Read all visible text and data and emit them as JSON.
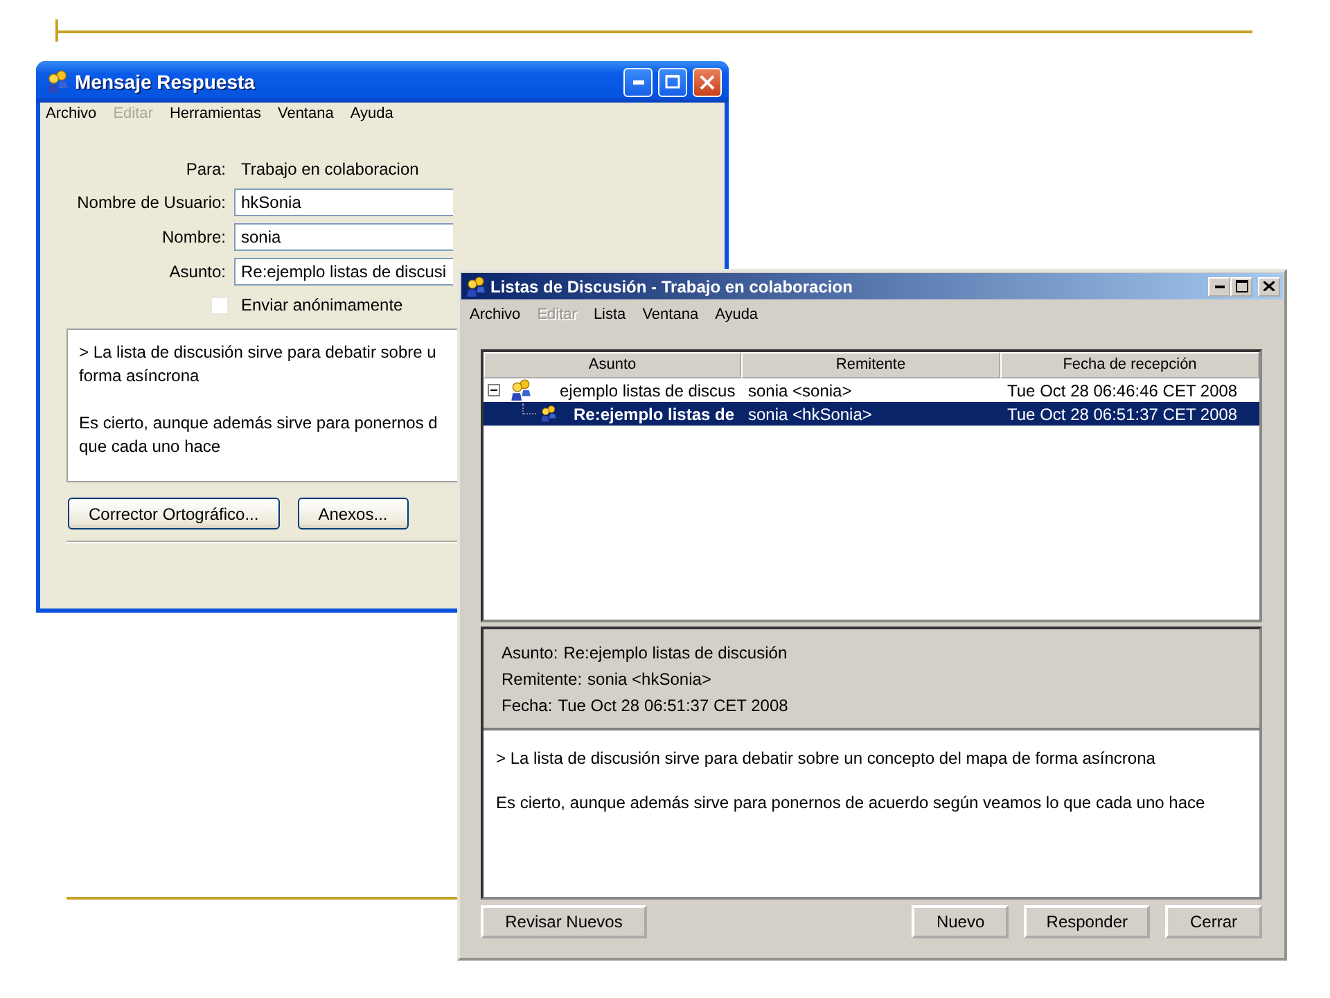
{
  "reply_window": {
    "title": "Mensaje Respuesta",
    "menu": [
      {
        "label": "Archivo",
        "disabled": false
      },
      {
        "label": "Editar",
        "disabled": true
      },
      {
        "label": "Herramientas",
        "disabled": false
      },
      {
        "label": "Ventana",
        "disabled": false
      },
      {
        "label": "Ayuda",
        "disabled": false
      }
    ],
    "fields": [
      {
        "label": "Para:",
        "kind": "static",
        "value": "Trabajo en colaboracion"
      },
      {
        "label": "Nombre de Usuario:",
        "kind": "input",
        "value": "hkSonia"
      },
      {
        "label": "Nombre:",
        "kind": "input",
        "value": "sonia"
      },
      {
        "label": "Asunto:",
        "kind": "input",
        "value": "Re:ejemplo listas de discusi"
      }
    ],
    "checkbox": {
      "label": "Enviar anónimamente",
      "checked": false
    },
    "message_paragraphs": [
      [
        "> La lista de discusión sirve para debatir sobre u",
        "forma asíncrona"
      ],
      [
        "Es cierto, aunque además sirve para ponernos d",
        "que cada uno hace"
      ]
    ],
    "buttons": [
      "Corrector Ortográfico...",
      "Anexos..."
    ]
  },
  "list_window": {
    "title": "Listas de Discusión - Trabajo en colaboracion",
    "menu": [
      {
        "label": "Archivo",
        "disabled": false
      },
      {
        "label": "Editar",
        "disabled": true
      },
      {
        "label": "Lista",
        "disabled": false
      },
      {
        "label": "Ventana",
        "disabled": false
      },
      {
        "label": "Ayuda",
        "disabled": false
      }
    ],
    "table": {
      "columns": [
        "Asunto",
        "Remitente",
        "Fecha de recepción"
      ],
      "rows": [
        {
          "subject": "ejemplo listas de discus",
          "sender": "sonia <sonia>",
          "date": "Tue Oct 28 06:46:46 CET 2008",
          "expanded": true,
          "selected": false,
          "children": [
            {
              "subject": "Re:ejemplo listas de",
              "sender": "sonia <hkSonia>",
              "date": "Tue Oct 28 06:51:37 CET 2008",
              "selected": true
            }
          ]
        }
      ]
    },
    "details": [
      {
        "label": "Asunto:",
        "value": "Re:ejemplo listas de discusión"
      },
      {
        "label": "Remitente:",
        "value": "sonia <hkSonia>"
      },
      {
        "label": "Fecha:",
        "value": "Tue Oct 28 06:51:37 CET 2008"
      }
    ],
    "message_paragraphs": [
      [
        "> La lista de discusión sirve para debatir sobre un concepto del mapa de forma asíncrona"
      ],
      [
        "Es cierto, aunque además sirve para ponernos de acuerdo según veamos lo que cada uno hace"
      ]
    ],
    "left_buttons": [
      "Revisar Nuevos"
    ],
    "right_buttons": [
      "Nuevo",
      "Responder",
      "Cerrar"
    ]
  }
}
